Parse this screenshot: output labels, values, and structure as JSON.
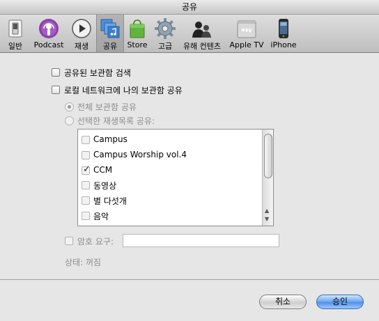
{
  "window": {
    "title": "공유"
  },
  "toolbar": {
    "items": [
      {
        "label": "일반",
        "icon": "switch-icon"
      },
      {
        "label": "Podcast",
        "icon": "podcast-icon"
      },
      {
        "label": "재생",
        "icon": "play-icon"
      },
      {
        "label": "공유",
        "icon": "sharing-icon",
        "selected": true
      },
      {
        "label": "Store",
        "icon": "store-bag-icon"
      },
      {
        "label": "고급",
        "icon": "gear-icon"
      },
      {
        "label": "유해 컨텐츠",
        "icon": "parental-icon"
      },
      {
        "label": "Apple TV",
        "icon": "apple-tv-icon"
      },
      {
        "label": "iPhone",
        "icon": "iphone-icon"
      }
    ]
  },
  "sharing": {
    "look_for_shared": "공유된 보관함 검색",
    "share_library": "로컬 네트워크에 나의 보관함 공유",
    "share_entire": "전체 보관함 공유",
    "share_selected": "선택한 재생목록 공유:",
    "playlists": [
      {
        "name": "Campus",
        "checked": false
      },
      {
        "name": "Campus Worship vol.4",
        "checked": false
      },
      {
        "name": "CCM",
        "checked": true
      },
      {
        "name": "동영상",
        "checked": false
      },
      {
        "name": "별 다섯개",
        "checked": false
      },
      {
        "name": "음악",
        "checked": false
      }
    ],
    "require_password": "암호 요구:",
    "password_value": "",
    "status": "상태: 꺼짐"
  },
  "buttons": {
    "cancel": "취소",
    "ok": "승인"
  }
}
